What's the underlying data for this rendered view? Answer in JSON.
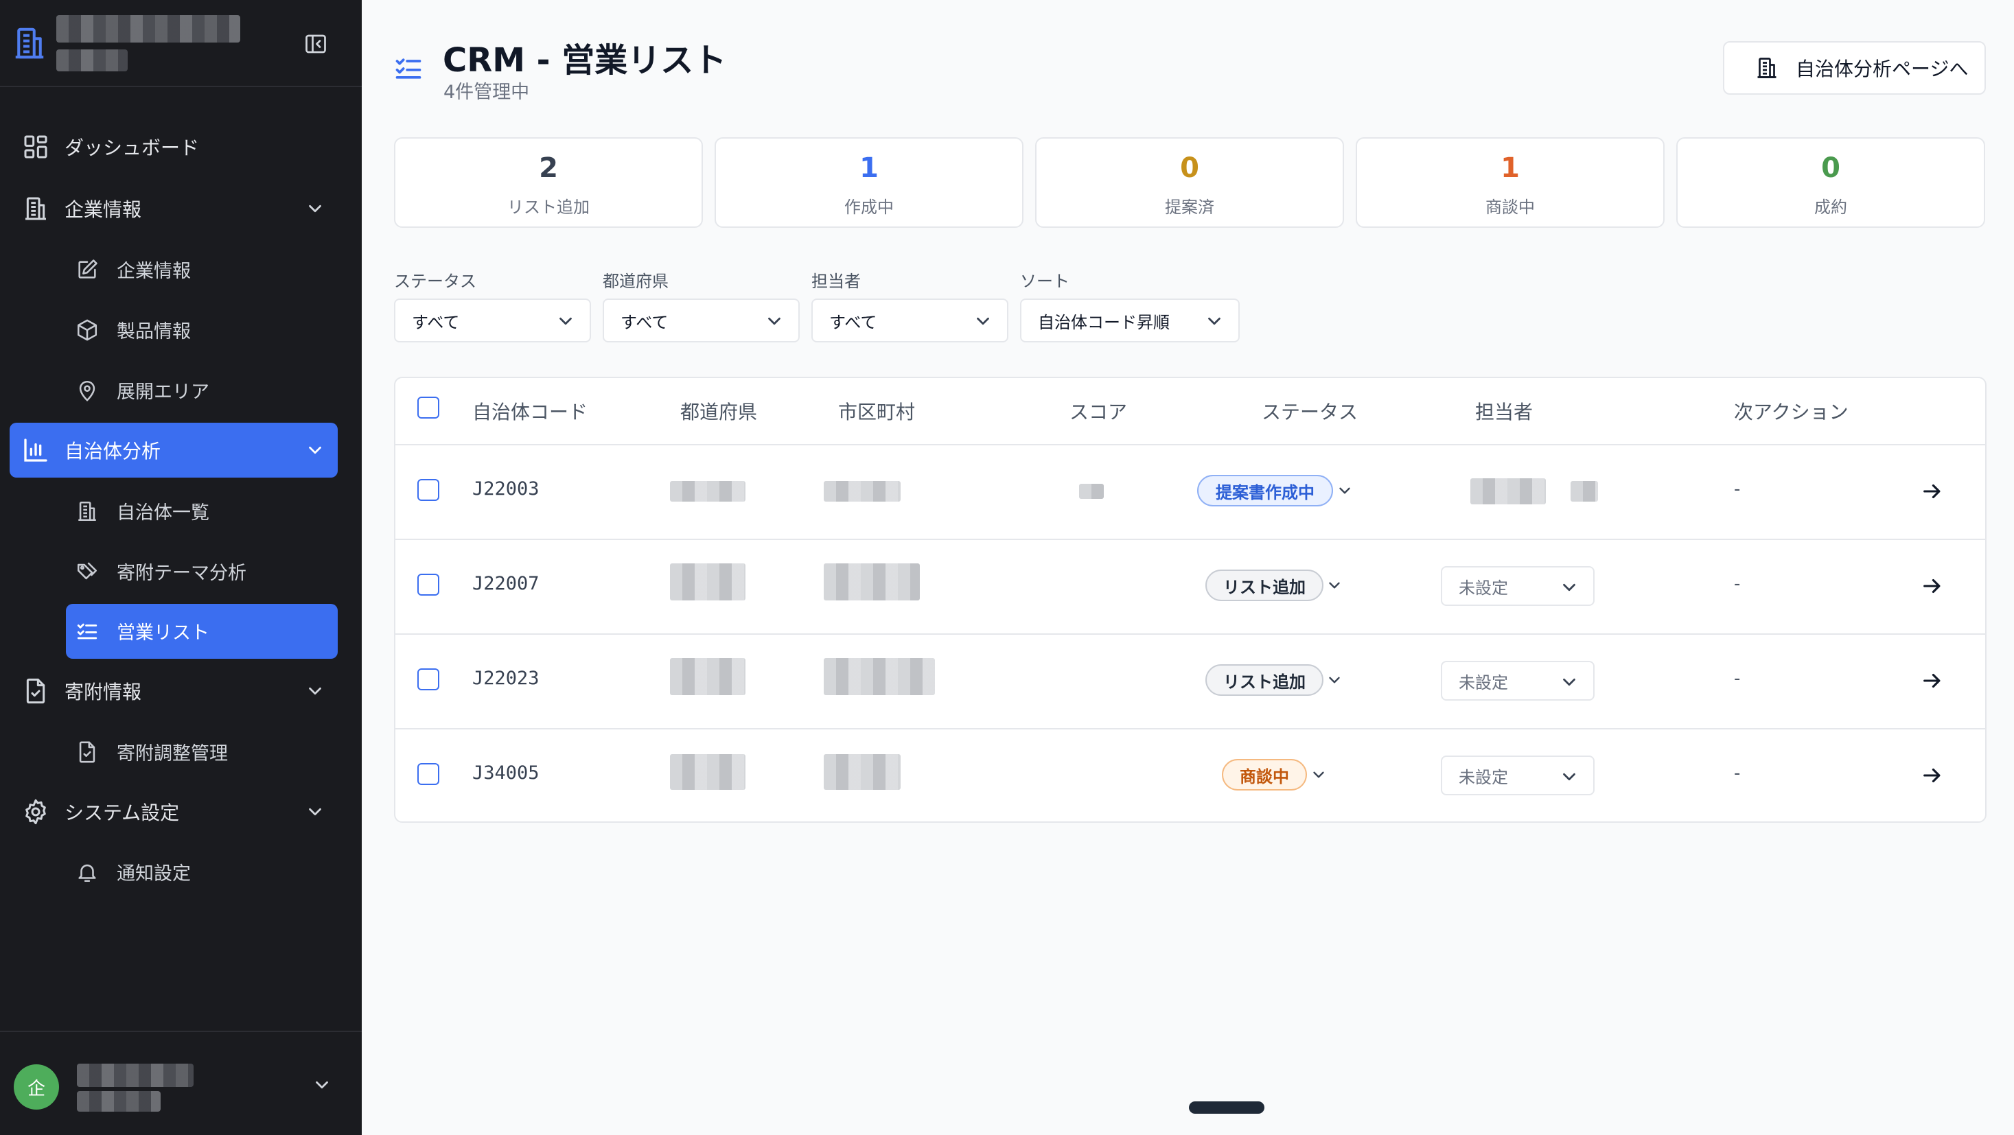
{
  "sidebar": {
    "items": [
      {
        "label": "ダッシュボード",
        "icon": "dashboard-icon"
      },
      {
        "label": "企業情報",
        "icon": "building-icon"
      },
      {
        "label": "企業情報",
        "icon": "edit-icon"
      },
      {
        "label": "製品情報",
        "icon": "box-icon"
      },
      {
        "label": "展開エリア",
        "icon": "map-pin-icon"
      },
      {
        "label": "自治体分析",
        "icon": "bar-chart-icon"
      },
      {
        "label": "自治体一覧",
        "icon": "building-icon"
      },
      {
        "label": "寄附テーマ分析",
        "icon": "tags-icon"
      },
      {
        "label": "営業リスト",
        "icon": "list-check-icon"
      },
      {
        "label": "寄附情報",
        "icon": "file-check-icon"
      },
      {
        "label": "寄附調整管理",
        "icon": "file-check-icon"
      },
      {
        "label": "システム設定",
        "icon": "gear-icon"
      },
      {
        "label": "通知設定",
        "icon": "bell-icon"
      }
    ],
    "avatar_initial": "企"
  },
  "header": {
    "title": "CRM - 営業リスト",
    "subtitle": "4件管理中",
    "action_label": "自治体分析ページへ"
  },
  "stats": [
    {
      "value": "2",
      "label": "リスト追加",
      "color": "#374151"
    },
    {
      "value": "1",
      "label": "作成中",
      "color": "#3b6ef0"
    },
    {
      "value": "0",
      "label": "提案済",
      "color": "#c7911b"
    },
    {
      "value": "1",
      "label": "商談中",
      "color": "#e0622a"
    },
    {
      "value": "0",
      "label": "成約",
      "color": "#4a9a4e"
    }
  ],
  "filters": [
    {
      "label": "ステータス",
      "value": "すべて"
    },
    {
      "label": "都道府県",
      "value": "すべて"
    },
    {
      "label": "担当者",
      "value": "すべて"
    },
    {
      "label": "ソート",
      "value": "自治体コード昇順"
    }
  ],
  "table": {
    "columns": [
      "自治体コード",
      "都道府県",
      "市区町村",
      "スコア",
      "ステータス",
      "担当者",
      "次アクション"
    ],
    "rows": [
      {
        "code": "J22003",
        "status": "提案書作成中",
        "assignee": "",
        "next_action": "-"
      },
      {
        "code": "J22007",
        "status": "リスト追加",
        "assignee": "未設定",
        "next_action": "-"
      },
      {
        "code": "J22023",
        "status": "リスト追加",
        "assignee": "未設定",
        "next_action": "-"
      },
      {
        "code": "J34005",
        "status": "商談中",
        "assignee": "未設定",
        "next_action": "-"
      }
    ]
  }
}
